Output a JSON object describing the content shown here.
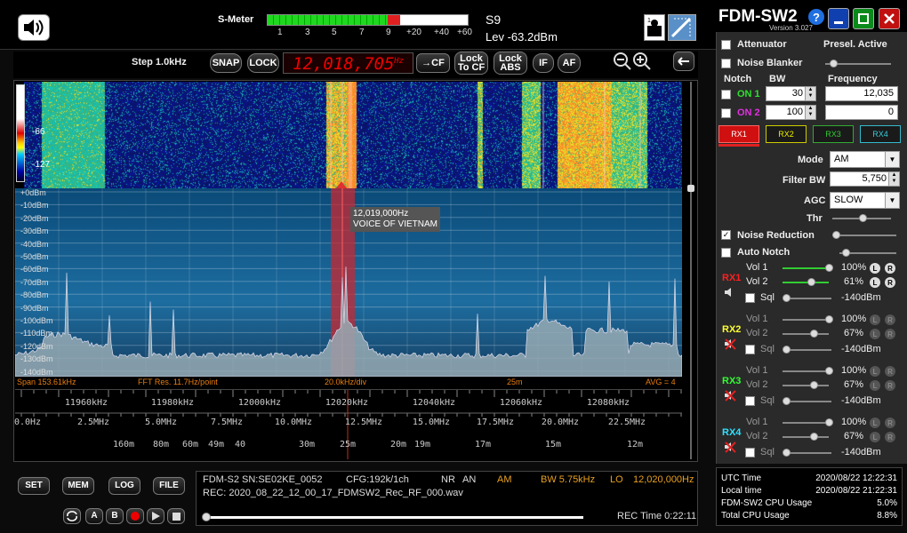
{
  "title": {
    "name": "FDM-SW2",
    "version": "Version 3.027",
    "help": "?"
  },
  "smeter": {
    "label": "S-Meter",
    "ticks": [
      "1",
      "3",
      "5",
      "7",
      "9",
      "+20",
      "+40",
      "+60"
    ],
    "s_reading": "S9",
    "level": "Lev -63.2dBm",
    "fill_fraction": 0.66
  },
  "controls": {
    "step": "Step 1.0kHz",
    "snap": "SNAP",
    "lock": "LOCK",
    "frequency": "12,018,705",
    "freq_unit": "Hz",
    "to_cf": "→CF",
    "lock_to_cf": [
      "Lock",
      "To CF"
    ],
    "lock_abs": [
      "Lock",
      "ABS"
    ],
    "if": "IF",
    "af": "AF"
  },
  "waterfall": {
    "max_label": "-66",
    "min_label": "-127"
  },
  "spectrum": {
    "db_labels": [
      "+0dBm",
      "-10dBm",
      "-20dBm",
      "-30dBm",
      "-40dBm",
      "-50dBm",
      "-60dBm",
      "-70dBm",
      "-80dBm",
      "-90dBm",
      "-100dBm",
      "-110dBm",
      "-120dBm",
      "-130dBm",
      "-140dBm"
    ],
    "tooltip_freq": "12,019,000Hz",
    "tooltip_station": "VOICE OF VIETNAM",
    "span": "Span 153.61kHz",
    "fft_res": "FFT Res. 11.7Hz/point",
    "div": "20.0kHz/div",
    "band": "25m",
    "avg": "AVG = 4"
  },
  "axis": {
    "khz": [
      "11960kHz",
      "11980kHz",
      "12000kHz",
      "12020kHz",
      "12040kHz",
      "12060kHz",
      "12080kHz"
    ],
    "mhz": [
      "0.0Hz",
      "2.5MHz",
      "5.0MHz",
      "7.5MHz",
      "10.0MHz",
      "12.5MHz",
      "15.0MHz",
      "17.5MHz",
      "20.0MHz",
      "22.5MHz"
    ],
    "bands": [
      "160m",
      "80m",
      "60m",
      "49m",
      "40",
      "30m",
      "25m",
      "20m",
      "19m",
      "17m",
      "15m",
      "12m"
    ]
  },
  "bottom_buttons": {
    "set": "SET",
    "mem": "MEM",
    "log": "LOG",
    "file": "FILE",
    "a": "A",
    "b": "B"
  },
  "status": {
    "device": "FDM-S2 SN:SE02KE_0052",
    "cfg": "CFG:192k/1ch",
    "nr": "NR",
    "an": "AN",
    "mode": "AM",
    "bw": "BW 5.75kHz",
    "lo_label": "LO",
    "lo_value": "12,020,000Hz",
    "rec_file": "REC: 2020_08_22_12_00_17_FDMSW2_Rec_RF_000.wav",
    "rec_time": "REC Time 0:22:11"
  },
  "panel": {
    "attenuator": "Attenuator",
    "presel": "Presel. Active",
    "noise_blanker": "Noise Blanker",
    "notch": "Notch",
    "bw": "BW",
    "frequency": "Frequency",
    "on1": "ON 1",
    "on2": "ON 2",
    "notch1_bw": "30",
    "notch1_freq": "12,035",
    "notch2_bw": "100",
    "notch2_freq": "0",
    "rx_tabs": [
      "RX1",
      "RX2",
      "RX3",
      "RX4"
    ],
    "mode_label": "Mode",
    "mode_value": "AM",
    "filter_label": "Filter BW",
    "filter_value": "5,750",
    "agc_label": "AGC",
    "agc_value": "SLOW",
    "thr": "Thr",
    "noise_reduction": "Noise Reduction",
    "auto_notch": "Auto Notch",
    "vol1": "Vol 1",
    "vol2": "Vol 2",
    "sql": "Sql",
    "L": "L",
    "R": "R",
    "rx": [
      {
        "name": "RX1",
        "vol1": "100%",
        "vol2": "61%",
        "sql": "-140dBm",
        "color": "#ff2020",
        "vol1_frac": 1.0,
        "vol2_frac": 0.61
      },
      {
        "name": "RX2",
        "vol1": "100%",
        "vol2": "67%",
        "sql": "-140dBm",
        "color": "#ffff30",
        "vol1_frac": 1.0,
        "vol2_frac": 0.67
      },
      {
        "name": "RX3",
        "vol1": "100%",
        "vol2": "67%",
        "sql": "-140dBm",
        "color": "#30ff30",
        "vol1_frac": 1.0,
        "vol2_frac": 0.67
      },
      {
        "name": "RX4",
        "vol1": "100%",
        "vol2": "67%",
        "sql": "-140dBm",
        "color": "#30e0ff",
        "vol1_frac": 1.0,
        "vol2_frac": 0.67
      }
    ]
  },
  "info": {
    "utc_label": "UTC Time",
    "utc_value": "2020/08/22 12:22:31",
    "local_label": "Local time",
    "local_value": "2020/08/22 21:22:31",
    "cpu_label": "FDM-SW2 CPU Usage",
    "cpu_value": "5.0%",
    "total_label": "Total CPU Usage",
    "total_value": "8.8%"
  }
}
